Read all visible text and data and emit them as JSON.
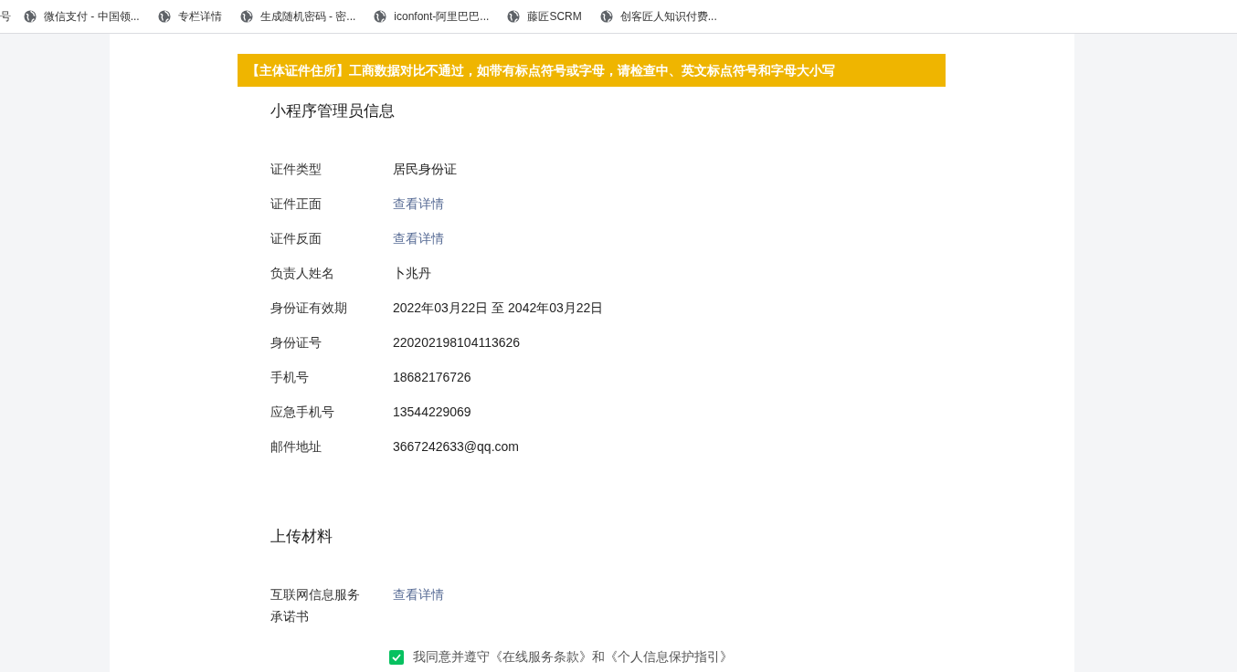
{
  "bookmarks": [
    {
      "label": "号"
    },
    {
      "label": "微信支付 - 中国领..."
    },
    {
      "label": "专栏详情"
    },
    {
      "label": "生成随机密码 - 密..."
    },
    {
      "label": "iconfont-阿里巴巴..."
    },
    {
      "label": "藤匠SCRM"
    },
    {
      "label": "创客匠人知识付费..."
    }
  ],
  "alert": "【主体证件住所】工商数据对比不通过，如带有标点符号或字母，请检查中、英文标点符号和字母大小写",
  "sections": [
    {
      "title": "小程序管理员信息",
      "rows": [
        {
          "label": "证件类型",
          "value": "居民身份证",
          "kind": "text"
        },
        {
          "label": "证件正面",
          "value": "查看详情",
          "kind": "link"
        },
        {
          "label": "证件反面",
          "value": "查看详情",
          "kind": "link"
        },
        {
          "label": "负责人姓名",
          "value": "卜兆丹",
          "kind": "text"
        },
        {
          "label": "身份证有效期",
          "value": "2022年03月22日 至 2042年03月22日",
          "kind": "text"
        },
        {
          "label": "身份证号",
          "value": "220202198104113626",
          "kind": "text"
        },
        {
          "label": "手机号",
          "value": "18682176726",
          "kind": "text"
        },
        {
          "label": "应急手机号",
          "value": "13544229069",
          "kind": "text"
        },
        {
          "label": "邮件地址",
          "value": "3667242633@qq.com",
          "kind": "text"
        }
      ]
    },
    {
      "title": "上传材料",
      "rows": [
        {
          "label": "互联网信息服务承诺书",
          "value": "查看详情",
          "kind": "link"
        }
      ]
    }
  ],
  "agreement": {
    "checked": true,
    "text": "我同意并遵守《在线服务条款》和《个人信息保护指引》"
  }
}
